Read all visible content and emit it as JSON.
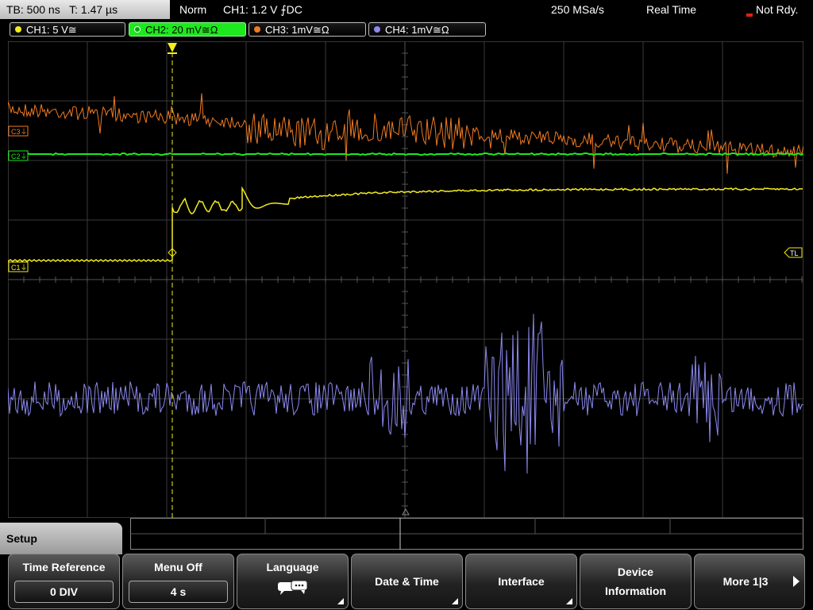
{
  "status": {
    "timebase": "TB: 500 ns",
    "time": "T: 1.47 µs",
    "trigger_mode": "Norm",
    "trigger": "CH1: 1.2 V ⨍DC",
    "sample_rate": "250 MSa/s",
    "acq_mode": "Real Time",
    "state": "Not Rdy."
  },
  "channels": [
    {
      "label": "CH1: 5 V≅",
      "color": "#f3ec1e"
    },
    {
      "label": "CH2: 20 mV≅Ω",
      "color": "#1ee81e"
    },
    {
      "label": "CH3: 1mV≅Ω",
      "color": "#f07b22"
    },
    {
      "label": "CH4: 1mV≅Ω",
      "color": "#8c89f0"
    }
  ],
  "markers": {
    "c3": "C3⏚",
    "c2": "C2⏚",
    "c1": "C1⏚",
    "trigger_level": "TL"
  },
  "menu": {
    "title": "Setup",
    "softkeys": {
      "time_reference": {
        "title": "Time Reference",
        "value": "0 DIV"
      },
      "menu_off": {
        "title": "Menu Off",
        "value": "4 s"
      },
      "language": {
        "title": "Language",
        "icon": "speech-bubbles-icon"
      },
      "date_time": {
        "title": "Date & Time"
      },
      "interface": {
        "title": "Interface"
      },
      "device_info": {
        "line1": "Device",
        "line2": "Information"
      },
      "more": {
        "title": "More 1|3"
      }
    }
  },
  "colors": {
    "grid": "#3a3a3a",
    "ch1": "#f3ec1e",
    "ch2": "#1ee81e",
    "ch3": "#f07b22",
    "ch4": "#8c89f0"
  }
}
